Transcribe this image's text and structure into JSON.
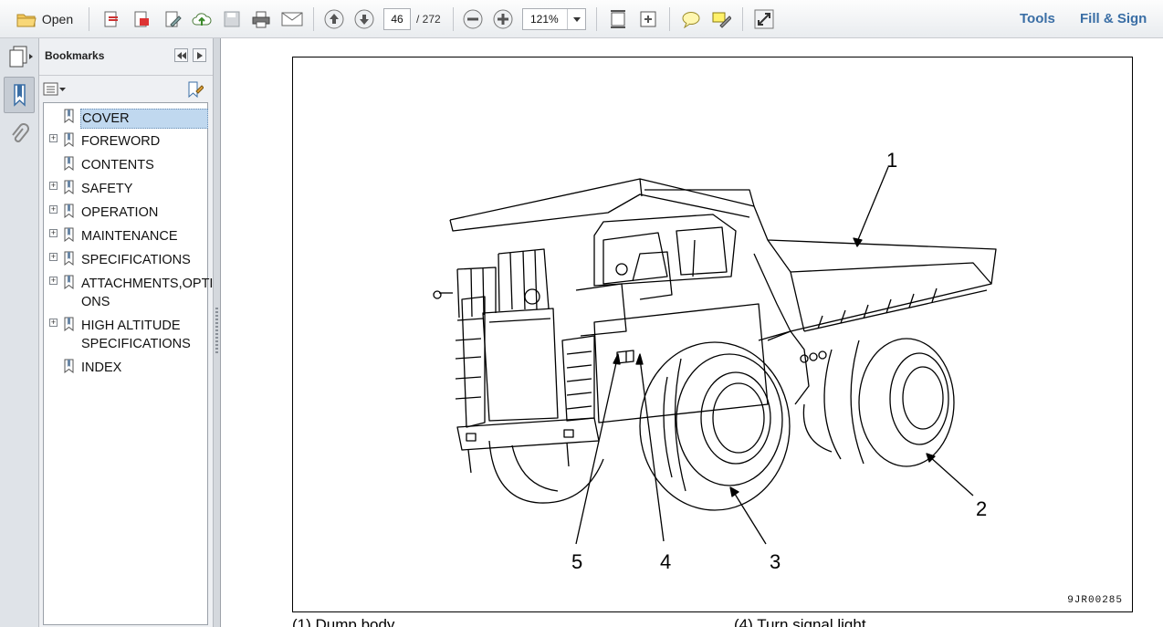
{
  "toolbar": {
    "open_label": "Open",
    "page_current": "46",
    "page_total": "/ 272",
    "zoom": "121%",
    "tools_label": "Tools",
    "fill_sign_label": "Fill & Sign"
  },
  "panel": {
    "title": "Bookmarks",
    "items": [
      {
        "label": "COVER",
        "expandable": false,
        "selected": true
      },
      {
        "label": "FOREWORD",
        "expandable": true
      },
      {
        "label": "CONTENTS",
        "expandable": false
      },
      {
        "label": "SAFETY",
        "expandable": true
      },
      {
        "label": "OPERATION",
        "expandable": true
      },
      {
        "label": "MAINTENANCE",
        "expandable": true
      },
      {
        "label": "SPECIFICATIONS",
        "expandable": true
      },
      {
        "label": "ATTACHMENTS,OPTIONS",
        "line1": "ATTACHMENTS,OPTI",
        "line2": "ONS",
        "expandable": true
      },
      {
        "label": "HIGH ALTITUDE SPECIFICATIONS",
        "line1": "HIGH ALTITUDE",
        "line2": "SPECIFICATIONS",
        "expandable": true
      },
      {
        "label": "INDEX",
        "expandable": false
      }
    ]
  },
  "document": {
    "figure_code": "9JR00285",
    "callouts": [
      "1",
      "2",
      "3",
      "4",
      "5"
    ],
    "caption_left": "(1) Dump body",
    "caption_right": "(4) Turn signal light"
  }
}
